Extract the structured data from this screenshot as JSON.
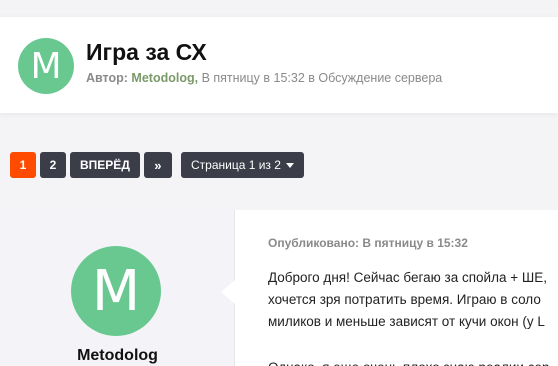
{
  "topic": {
    "avatar_letter": "M",
    "title": "Игра за СХ",
    "meta_prefix": "Автор:",
    "author": "Metodolog,",
    "date": "В пятницу в 15:32",
    "in_text": "в",
    "forum": "Обсуждение сервера"
  },
  "pagination": {
    "pages": [
      "1",
      "2"
    ],
    "active": "1",
    "next_label": "ВПЕРЁД",
    "last_icon": "»",
    "page_jump_label": "Страница 1 из 2"
  },
  "post": {
    "author_avatar_letter": "M",
    "author_name": "Metodolog",
    "published": "Опубликовано: В пятницу в 15:32",
    "lines": [
      "Доброго дня! Сейчас бегаю за спойла + ШЕ,",
      "хочется зря потратить время. Играю в соло",
      "миликов и меньше зависят от кучи окон (у L"
    ],
    "second_line": "Однако, я еще очень плохо знаю реалии сер"
  },
  "colors": {
    "accent": "#ff4b00",
    "avatar": "#68c890",
    "dark_button": "#3b3e48"
  }
}
